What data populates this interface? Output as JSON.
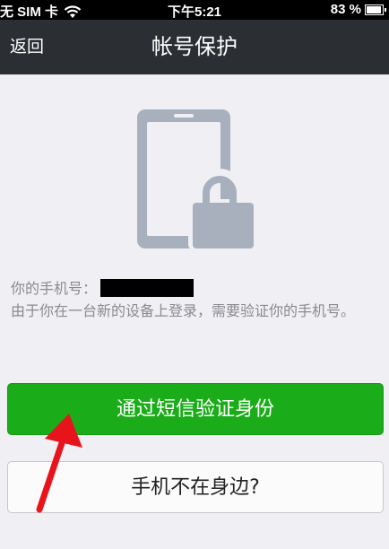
{
  "status_bar": {
    "carrier": "无 SIM 卡",
    "time": "下午5:21",
    "battery": "83 %"
  },
  "nav": {
    "back_label": "返回",
    "title": "帐号保护"
  },
  "info": {
    "phone_label": "你的手机号：",
    "message": "由于你在一台新的设备上登录，需要验证你的手机号。"
  },
  "buttons": {
    "verify_sms": "通过短信验证身份",
    "phone_not_nearby": "手机不在身边?"
  },
  "colors": {
    "primary_green": "#1aad19",
    "nav_background": "#2b2e33",
    "annotation_red": "#e8141c"
  },
  "icons": {
    "hero": "phone-lock-icon",
    "wifi": "wifi-icon",
    "battery": "battery-icon"
  }
}
